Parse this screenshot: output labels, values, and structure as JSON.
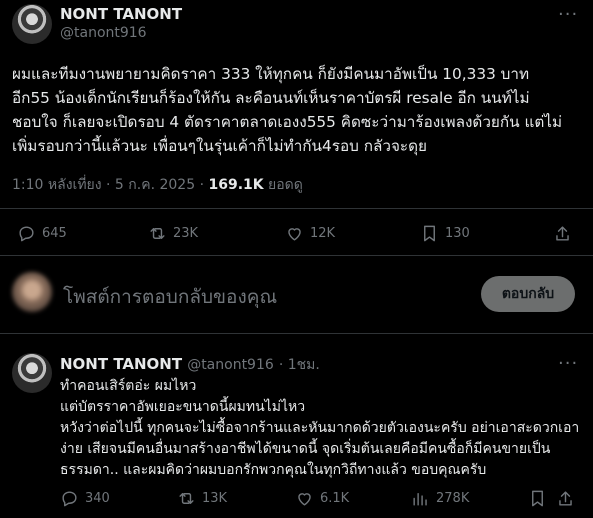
{
  "tweet": {
    "author_name": "NONT TANONT",
    "author_handle": "@tanont916",
    "more_icon": "more-dots-icon",
    "text": "ผมและทีมงานพยายามคิดราคา 333 ให้ทุกคน ก็ยังมีคนมาอัพเป็น 10,333 บาท\nอีก55 น้องเด็กนักเรียนก็ร้องให้กัน ละคือนนท์เห็นราคาบัตรผี resale อีก นนท์ไม่\nชอบใจ ก็เลยจะเปิดรอบ 4 ตัดราคาตลาดเองง555 คิดซะว่ามาร้องเพลงด้วยกัน แต่ไม่\nเพิ่มรอบกว่านี้แล้วนะ เพื่อนๆในรุ่นเค้าก็ไม่ทำกัน4รอบ กลัวจะดุย",
    "timestamp": "1:10 หลังเที่ยง · 5 ก.ค. 2025 · ",
    "views_count": "169.1K",
    "views_label": " ยอดดู",
    "replies": "645",
    "retweets": "23K",
    "likes": "12K",
    "bookmarks": "130"
  },
  "composer": {
    "placeholder": "โพสต์การตอบกลับของคุณ",
    "button_label": "ตอบกลับ"
  },
  "reply": {
    "author_name": "NONT TANONT",
    "author_handle": "@tanont916",
    "time": "· 1ชม.",
    "text": "ทำคอนเสิร์ตอ่ะ ผมไหว\nแต่บัตรราคาอัพเยอะขนาดนี้ผมทนไม่ไหว\nหวังว่าต่อไปนี้ ทุกคนจะไม่ซื้อจากร้านและหันมากดด้วยตัวเองนะครับ อย่าเอาสะดวกเอา\nง่าย เสียจนมีคนอื่นมาสร้างอาชีพได้ขนาดนี้ จุดเริ่มต้นเลยคือมีคนซื้อก็มีคนขายเป็น\nธรรมดา.. และผมคิดว่าผมบอกรักพวกคุณในทุกวิถีทางแล้ว ขอบคุณครับ",
    "replies": "340",
    "retweets": "13K",
    "likes": "6.1K",
    "views": "278K"
  }
}
